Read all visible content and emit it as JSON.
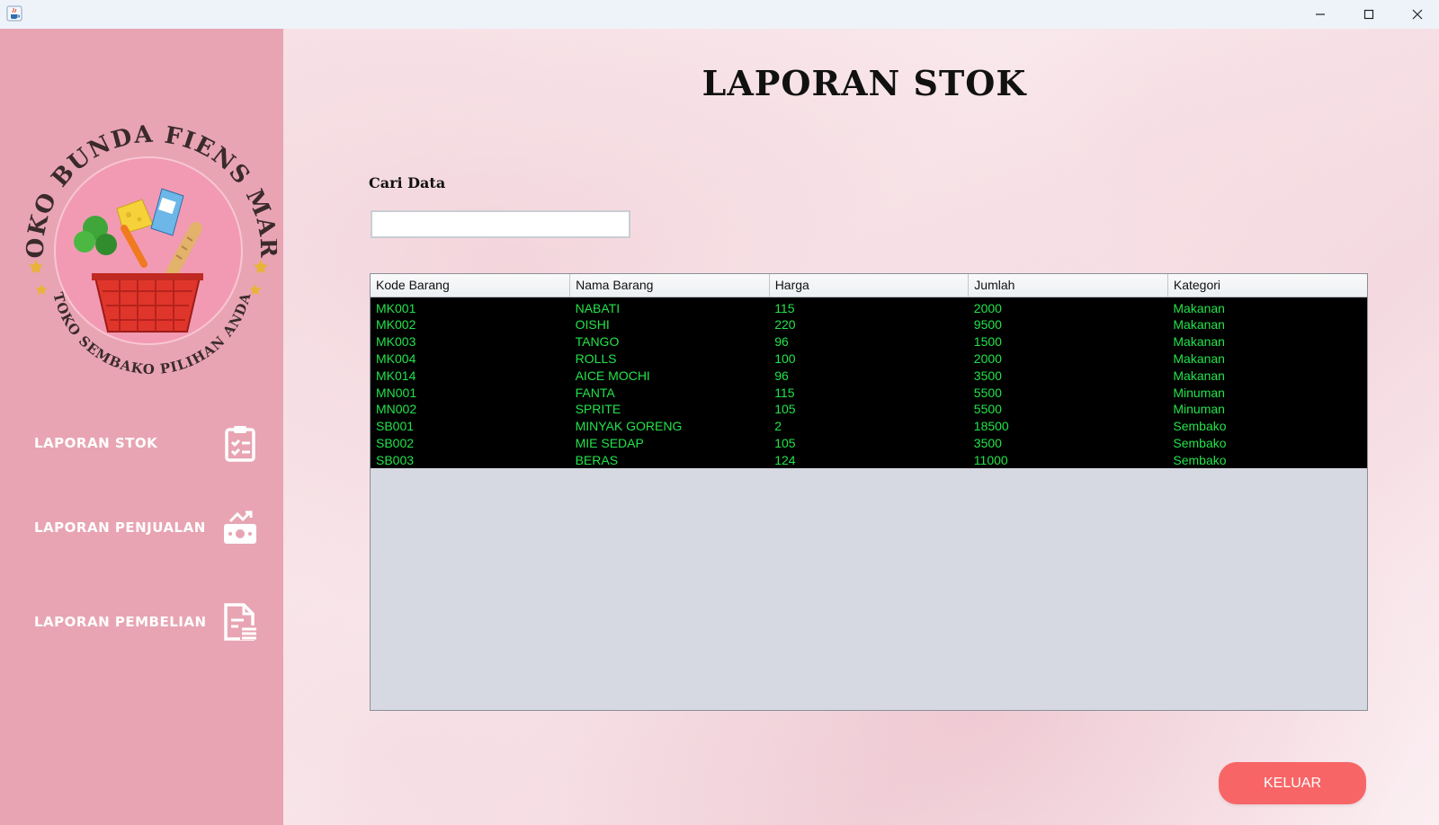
{
  "window": {
    "icons": {
      "app": "java-cup-icon",
      "minimize": "minimize-icon",
      "maximize": "maximize-icon",
      "close": "close-icon"
    }
  },
  "sidebar": {
    "logo": {
      "top_text": "TOKO BUNDA FIENS MART",
      "bottom_text": "TOKO SEMBAKO PILIHAN ANDA"
    },
    "items": [
      {
        "label": "LAPORAN STOK",
        "icon": "clipboard-list-icon"
      },
      {
        "label": "LAPORAN PENJUALAN",
        "icon": "money-up-icon"
      },
      {
        "label": "LAPORAN PEMBELIAN",
        "icon": "document-list-icon"
      }
    ]
  },
  "main": {
    "title": "LAPORAN STOK",
    "search": {
      "label": "Cari Data",
      "value": "",
      "placeholder": ""
    },
    "table": {
      "headers": [
        "Kode Barang",
        "Nama Barang",
        "Harga",
        "Jumlah",
        "Kategori"
      ],
      "rows": [
        [
          "MK001",
          "NABATI",
          "115",
          "2000",
          "Makanan"
        ],
        [
          "MK002",
          "OISHI",
          "220",
          "9500",
          "Makanan"
        ],
        [
          "MK003",
          "TANGO",
          "96",
          "1500",
          "Makanan"
        ],
        [
          "MK004",
          "ROLLS",
          "100",
          "2000",
          "Makanan"
        ],
        [
          "MK014",
          "AICE MOCHI",
          "96",
          "3500",
          "Makanan"
        ],
        [
          "MN001",
          "FANTA",
          "115",
          "5500",
          "Minuman"
        ],
        [
          "MN002",
          "SPRITE",
          "105",
          "5500",
          "Minuman"
        ],
        [
          "SB001",
          "MINYAK GORENG",
          "2",
          "18500",
          "Sembako"
        ],
        [
          "SB002",
          "MIE SEDAP",
          "105",
          "3500",
          "Sembako"
        ],
        [
          "SB003",
          "BERAS",
          "124",
          "11000",
          "Sembako"
        ]
      ]
    },
    "exit_button": "KELUAR"
  },
  "colors": {
    "sidebar": "#e8a4b2",
    "table_row_bg": "#000000",
    "table_text": "#22e34a",
    "exit_button": "#f86566"
  }
}
